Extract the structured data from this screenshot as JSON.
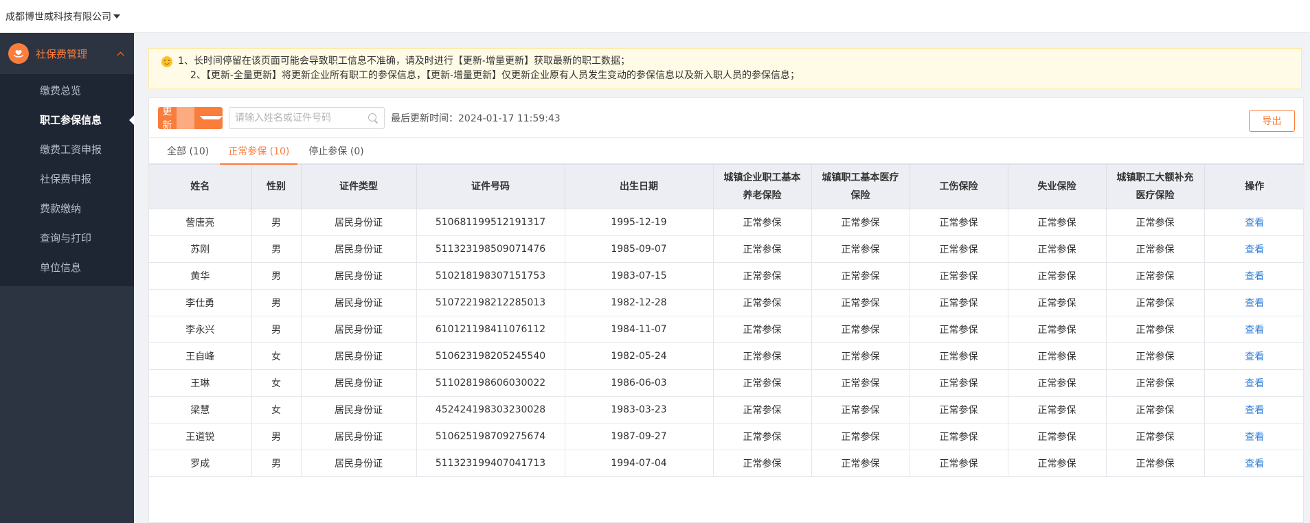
{
  "header": {
    "company": "成都博世威科技有限公司"
  },
  "sidebar": {
    "group_title": "社保费管理",
    "items": [
      {
        "label": "缴费总览",
        "active": false
      },
      {
        "label": "职工参保信息",
        "active": true
      },
      {
        "label": "缴费工资申报",
        "active": false
      },
      {
        "label": "社保费申报",
        "active": false
      },
      {
        "label": "费款缴纳",
        "active": false
      },
      {
        "label": "查询与打印",
        "active": false
      },
      {
        "label": "单位信息",
        "active": false
      }
    ]
  },
  "notice": {
    "line1": "1、长时间停留在该页面可能会导致职工信息不准确，请及时进行【更新-增量更新】获取最新的职工数据；",
    "line2": "2、【更新-全量更新】将更新企业所有职工的参保信息，【更新-增量更新】仅更新企业原有人员发生变动的参保信息以及新入职人员的参保信息；"
  },
  "toolbar": {
    "update_label": "更新",
    "search_placeholder": "请输入姓名或证件号码",
    "last_update_label": "最后更新时间：",
    "last_update_time": "2024-01-17 11:59:43",
    "export_label": "导出"
  },
  "tabs": [
    {
      "label": "全部 (10)",
      "active": false
    },
    {
      "label": "正常参保 (10)",
      "active": true
    },
    {
      "label": "停止参保 (0)",
      "active": false
    }
  ],
  "table": {
    "headers": [
      "姓名",
      "性别",
      "证件类型",
      "证件号码",
      "出生日期",
      "城镇企业职工基本养老保险",
      "城镇职工基本医疗保险",
      "工伤保险",
      "失业保险",
      "城镇职工大额补充医疗保险",
      "操作"
    ],
    "rows": [
      [
        "訾唐亮",
        "男",
        "居民身份证",
        "510681199512191317",
        "1995-12-19",
        "正常参保",
        "正常参保",
        "正常参保",
        "正常参保",
        "正常参保",
        "查看"
      ],
      [
        "苏刚",
        "男",
        "居民身份证",
        "511323198509071476",
        "1985-09-07",
        "正常参保",
        "正常参保",
        "正常参保",
        "正常参保",
        "正常参保",
        "查看"
      ],
      [
        "黄华",
        "男",
        "居民身份证",
        "510218198307151753",
        "1983-07-15",
        "正常参保",
        "正常参保",
        "正常参保",
        "正常参保",
        "正常参保",
        "查看"
      ],
      [
        "李仕勇",
        "男",
        "居民身份证",
        "510722198212285013",
        "1982-12-28",
        "正常参保",
        "正常参保",
        "正常参保",
        "正常参保",
        "正常参保",
        "查看"
      ],
      [
        "李永兴",
        "男",
        "居民身份证",
        "610121198411076112",
        "1984-11-07",
        "正常参保",
        "正常参保",
        "正常参保",
        "正常参保",
        "正常参保",
        "查看"
      ],
      [
        "王自峰",
        "女",
        "居民身份证",
        "510623198205245540",
        "1982-05-24",
        "正常参保",
        "正常参保",
        "正常参保",
        "正常参保",
        "正常参保",
        "查看"
      ],
      [
        "王琳",
        "女",
        "居民身份证",
        "511028198606030022",
        "1986-06-03",
        "正常参保",
        "正常参保",
        "正常参保",
        "正常参保",
        "正常参保",
        "查看"
      ],
      [
        "梁慧",
        "女",
        "居民身份证",
        "452424198303230028",
        "1983-03-23",
        "正常参保",
        "正常参保",
        "正常参保",
        "正常参保",
        "正常参保",
        "查看"
      ],
      [
        "王道锐",
        "男",
        "居民身份证",
        "510625198709275674",
        "1987-09-27",
        "正常参保",
        "正常参保",
        "正常参保",
        "正常参保",
        "正常参保",
        "查看"
      ],
      [
        "罗成",
        "男",
        "居民身份证",
        "511323199407041713",
        "1994-07-04",
        "正常参保",
        "正常参保",
        "正常参保",
        "正常参保",
        "正常参保",
        "查看"
      ]
    ]
  },
  "colors": {
    "accent": "#fa7d3c",
    "sidebar_bg": "#2c3442",
    "link": "#2f7fd8",
    "notice_bg": "#fffbe6"
  }
}
